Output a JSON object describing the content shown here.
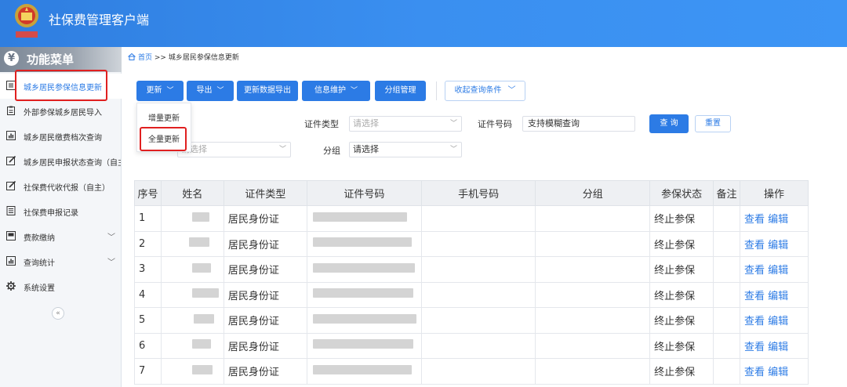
{
  "header": {
    "title": "社保费管理客户端"
  },
  "sidebar": {
    "menu_title": "功能菜单",
    "items": [
      {
        "label": "城乡居民参保信息更新",
        "icon": "list-icon",
        "active": true
      },
      {
        "label": "外部参保城乡居民导入",
        "icon": "clipboard-icon"
      },
      {
        "label": "城乡居民缴费档次查询",
        "icon": "bar-chart-icon"
      },
      {
        "label": "城乡居民申报状态查询（自主",
        "icon": "edit-icon"
      },
      {
        "label": "社保费代收代报（自主）",
        "icon": "edit-icon"
      },
      {
        "label": "社保费申报记录",
        "icon": "document-icon"
      },
      {
        "label": "费款缴纳",
        "icon": "card-icon",
        "has_children": true
      },
      {
        "label": "查询统计",
        "icon": "bar-chart-icon",
        "has_children": true
      },
      {
        "label": "系统设置",
        "icon": "gear-icon"
      }
    ],
    "collapse_symbol": "«"
  },
  "breadcrumb": {
    "home": "首页",
    "sep": ">>",
    "current": "城乡居民参保信息更新"
  },
  "toolbar": {
    "update": "更新",
    "export": "导出",
    "update_export": "更新数据导出",
    "info_maintain": "信息维护",
    "group_manage": "分组管理",
    "collapse_query": "收起查询条件"
  },
  "dropdown": {
    "incremental": "增量更新",
    "full": "全量更新"
  },
  "filters": {
    "id_type_label": "证件类型",
    "id_type_placeholder": "请选择",
    "id_no_label": "证件号码",
    "id_no_value": "支持模糊查询",
    "query_button": "查 询",
    "reset_button": "重置",
    "row2_select_placeholder": "请选择",
    "group_label": "分组",
    "group_placeholder": "请选择"
  },
  "table": {
    "headers": [
      "序号",
      "姓名",
      "证件类型",
      "证件号码",
      "手机号码",
      "分组",
      "参保状态",
      "备注",
      "操作"
    ],
    "rows": [
      {
        "no": "1",
        "id_type": "居民身份证",
        "status": "终止参保",
        "view": "查看",
        "edit": "编辑"
      },
      {
        "no": "2",
        "id_type": "居民身份证",
        "status": "终止参保",
        "view": "查看",
        "edit": "编辑"
      },
      {
        "no": "3",
        "id_type": "居民身份证",
        "status": "终止参保",
        "view": "查看",
        "edit": "编辑"
      },
      {
        "no": "4",
        "id_type": "居民身份证",
        "status": "终止参保",
        "view": "查看",
        "edit": "编辑"
      },
      {
        "no": "5",
        "id_type": "居民身份证",
        "status": "终止参保",
        "view": "查看",
        "edit": "编辑"
      },
      {
        "no": "6",
        "id_type": "居民身份证",
        "status": "终止参保",
        "view": "查看",
        "edit": "编辑"
      },
      {
        "no": "7",
        "id_type": "居民身份证",
        "status": "终止参保",
        "view": "查看",
        "edit": "编辑"
      }
    ]
  },
  "colors": {
    "primary": "#2c7be5",
    "highlight_border": "#e02020"
  }
}
